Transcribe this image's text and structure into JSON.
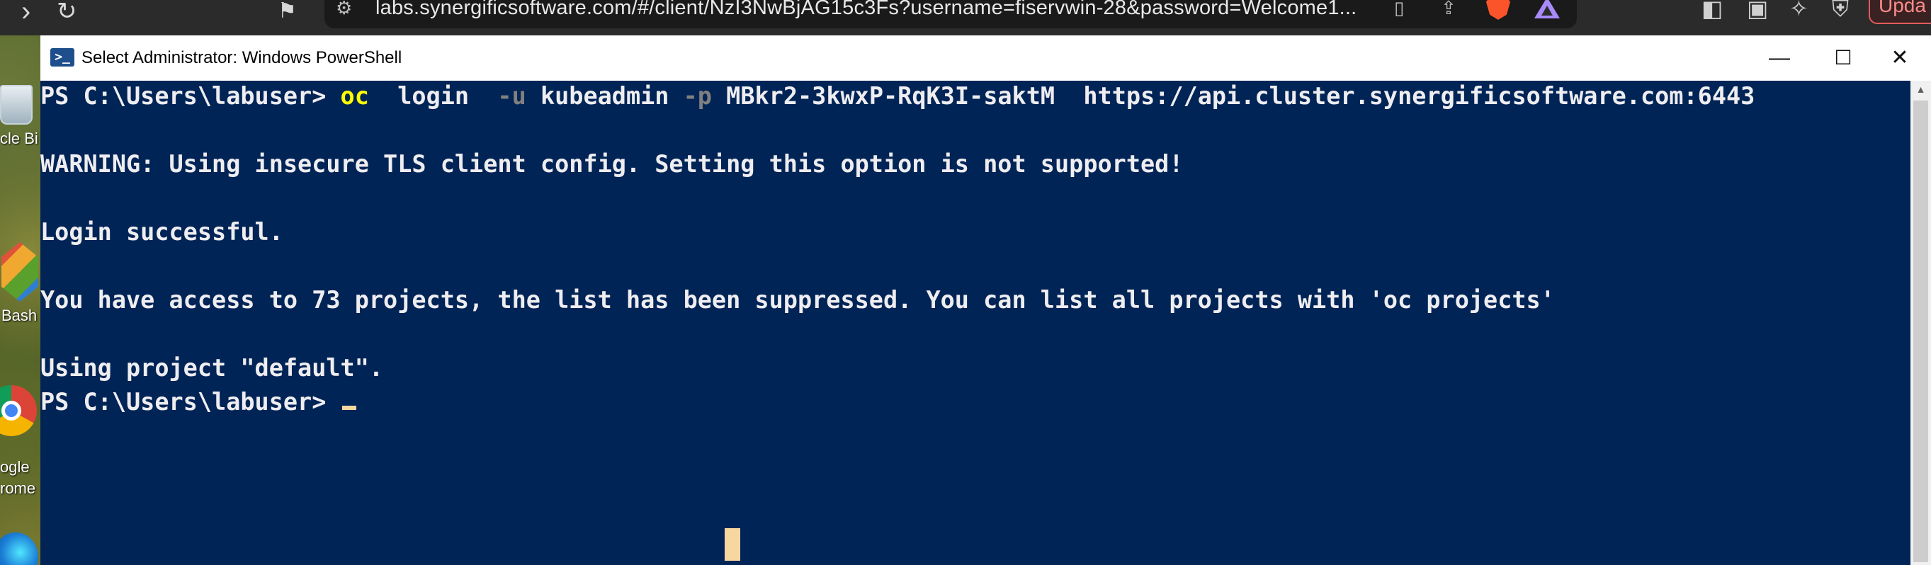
{
  "browser": {
    "address": "labs.synergificsoftware.com/#/client/NzI3NwBjAG15c3Fs?username=fiservwin-28&password=Welcome1...",
    "update_label": "Upda"
  },
  "desktop": {
    "recycle_bin_label": "cle Bi",
    "git_bash_label": "Bash",
    "chrome_label_1": "ogle",
    "chrome_label_2": "rome"
  },
  "window": {
    "title": "Select Administrator: Windows PowerShell",
    "controls": {
      "minimize": "—",
      "maximize": "☐",
      "close": "✕"
    }
  },
  "console": {
    "prompt": "PS C:\\Users\\labuser> ",
    "command": {
      "name": "oc",
      "arg1": "login",
      "flag_user": "-u",
      "user": "kubeadmin",
      "flag_password": "-p",
      "password": "MBkr2-3kwxP-RqK3I-saktM",
      "server": "https://api.cluster.synergificsoftware.com:6443"
    },
    "warning": "WARNING: Using insecure TLS client config. Setting this option is not supported!",
    "login_result": "Login successful.",
    "projects_info": "You have access to 73 projects, the list has been suppressed. You can list all projects with 'oc projects'",
    "using_project": "Using project \"default\".",
    "prompt_final": "PS C:\\Users\\labuser> "
  }
}
